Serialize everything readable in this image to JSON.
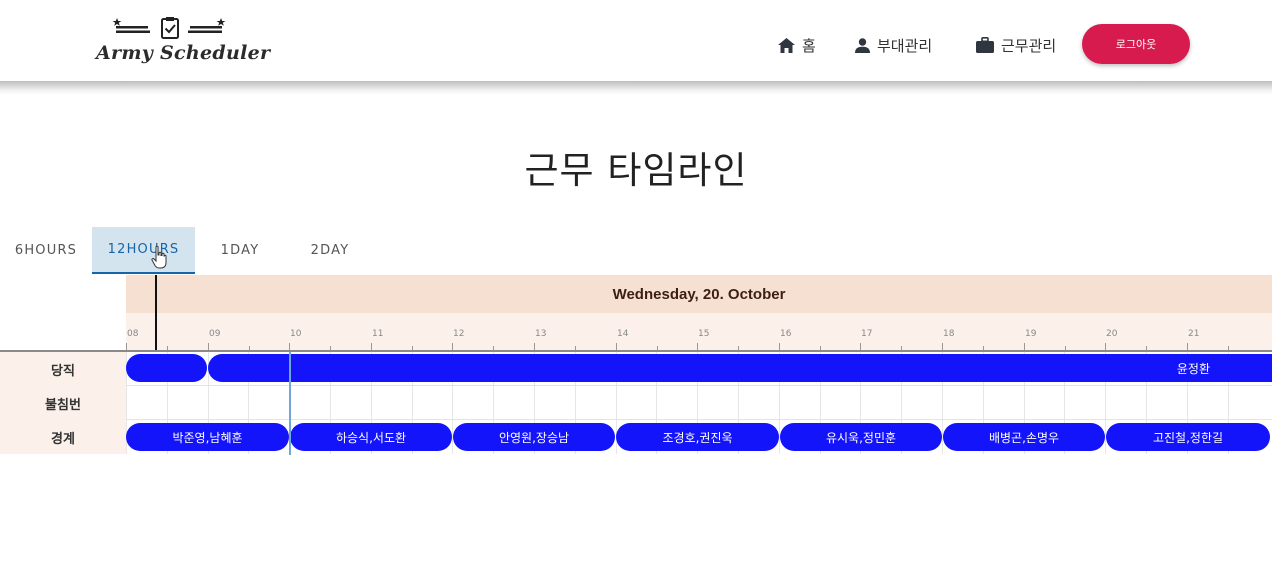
{
  "nav": {
    "logo_text": "Army Scheduler",
    "items": [
      {
        "label": "홈",
        "icon": "home-icon"
      },
      {
        "label": "부대관리",
        "icon": "person-icon"
      },
      {
        "label": "근무관리",
        "icon": "briefcase-icon"
      }
    ],
    "logout_label": "로그아웃"
  },
  "page": {
    "title": "근무 타임라인"
  },
  "tabs": [
    {
      "label": "6HOURS",
      "active": false
    },
    {
      "label": "12HOURS",
      "active": true
    },
    {
      "label": "1DAY",
      "active": false
    },
    {
      "label": "2DAY",
      "active": false
    }
  ],
  "timeline": {
    "date_label": "Wednesday, 20. October",
    "hours": [
      "08",
      "09",
      "10",
      "11",
      "12",
      "13",
      "14",
      "15",
      "16",
      "17",
      "18",
      "19",
      "20",
      "21"
    ],
    "rows": [
      {
        "label": "당직",
        "items": [
          {
            "label": ""
          },
          {
            "label": "윤정환"
          }
        ]
      },
      {
        "label": "불침번",
        "items": []
      },
      {
        "label": "경계",
        "items": [
          {
            "label": "박준영,남혜훈"
          },
          {
            "label": "하승식,서도환"
          },
          {
            "label": "안영원,장승남"
          },
          {
            "label": "조경호,권진욱"
          },
          {
            "label": "유시욱,정민훈"
          },
          {
            "label": "배병곤,손명우"
          },
          {
            "label": "고진철,정한길"
          }
        ]
      }
    ]
  },
  "colors": {
    "accent": "#d81b4e",
    "bar": "#1414fb",
    "active_tab": "#1565a8",
    "header_bg": "#f6e0d2"
  }
}
